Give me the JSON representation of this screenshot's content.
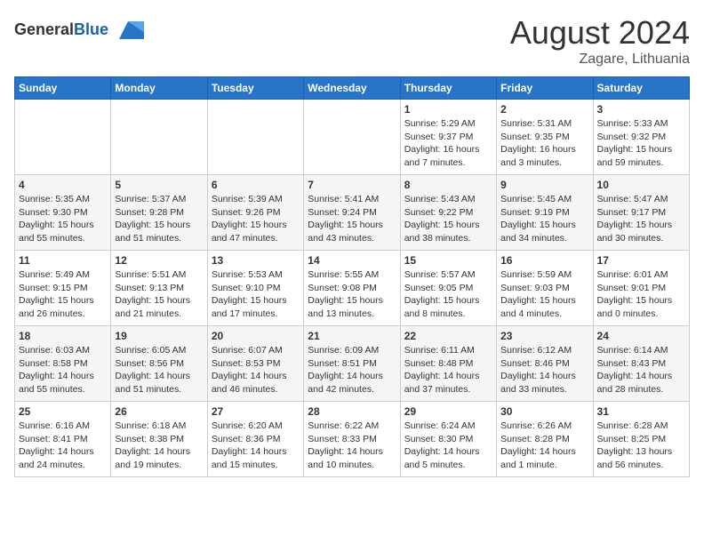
{
  "header": {
    "logo_general": "General",
    "logo_blue": "Blue",
    "month_title": "August 2024",
    "location": "Zagare, Lithuania"
  },
  "days_of_week": [
    "Sunday",
    "Monday",
    "Tuesday",
    "Wednesday",
    "Thursday",
    "Friday",
    "Saturday"
  ],
  "weeks": [
    [
      {
        "day": "",
        "info": ""
      },
      {
        "day": "",
        "info": ""
      },
      {
        "day": "",
        "info": ""
      },
      {
        "day": "",
        "info": ""
      },
      {
        "day": "1",
        "info": "Sunrise: 5:29 AM\nSunset: 9:37 PM\nDaylight: 16 hours\nand 7 minutes."
      },
      {
        "day": "2",
        "info": "Sunrise: 5:31 AM\nSunset: 9:35 PM\nDaylight: 16 hours\nand 3 minutes."
      },
      {
        "day": "3",
        "info": "Sunrise: 5:33 AM\nSunset: 9:32 PM\nDaylight: 15 hours\nand 59 minutes."
      }
    ],
    [
      {
        "day": "4",
        "info": "Sunrise: 5:35 AM\nSunset: 9:30 PM\nDaylight: 15 hours\nand 55 minutes."
      },
      {
        "day": "5",
        "info": "Sunrise: 5:37 AM\nSunset: 9:28 PM\nDaylight: 15 hours\nand 51 minutes."
      },
      {
        "day": "6",
        "info": "Sunrise: 5:39 AM\nSunset: 9:26 PM\nDaylight: 15 hours\nand 47 minutes."
      },
      {
        "day": "7",
        "info": "Sunrise: 5:41 AM\nSunset: 9:24 PM\nDaylight: 15 hours\nand 43 minutes."
      },
      {
        "day": "8",
        "info": "Sunrise: 5:43 AM\nSunset: 9:22 PM\nDaylight: 15 hours\nand 38 minutes."
      },
      {
        "day": "9",
        "info": "Sunrise: 5:45 AM\nSunset: 9:19 PM\nDaylight: 15 hours\nand 34 minutes."
      },
      {
        "day": "10",
        "info": "Sunrise: 5:47 AM\nSunset: 9:17 PM\nDaylight: 15 hours\nand 30 minutes."
      }
    ],
    [
      {
        "day": "11",
        "info": "Sunrise: 5:49 AM\nSunset: 9:15 PM\nDaylight: 15 hours\nand 26 minutes."
      },
      {
        "day": "12",
        "info": "Sunrise: 5:51 AM\nSunset: 9:13 PM\nDaylight: 15 hours\nand 21 minutes."
      },
      {
        "day": "13",
        "info": "Sunrise: 5:53 AM\nSunset: 9:10 PM\nDaylight: 15 hours\nand 17 minutes."
      },
      {
        "day": "14",
        "info": "Sunrise: 5:55 AM\nSunset: 9:08 PM\nDaylight: 15 hours\nand 13 minutes."
      },
      {
        "day": "15",
        "info": "Sunrise: 5:57 AM\nSunset: 9:05 PM\nDaylight: 15 hours\nand 8 minutes."
      },
      {
        "day": "16",
        "info": "Sunrise: 5:59 AM\nSunset: 9:03 PM\nDaylight: 15 hours\nand 4 minutes."
      },
      {
        "day": "17",
        "info": "Sunrise: 6:01 AM\nSunset: 9:01 PM\nDaylight: 15 hours\nand 0 minutes."
      }
    ],
    [
      {
        "day": "18",
        "info": "Sunrise: 6:03 AM\nSunset: 8:58 PM\nDaylight: 14 hours\nand 55 minutes."
      },
      {
        "day": "19",
        "info": "Sunrise: 6:05 AM\nSunset: 8:56 PM\nDaylight: 14 hours\nand 51 minutes."
      },
      {
        "day": "20",
        "info": "Sunrise: 6:07 AM\nSunset: 8:53 PM\nDaylight: 14 hours\nand 46 minutes."
      },
      {
        "day": "21",
        "info": "Sunrise: 6:09 AM\nSunset: 8:51 PM\nDaylight: 14 hours\nand 42 minutes."
      },
      {
        "day": "22",
        "info": "Sunrise: 6:11 AM\nSunset: 8:48 PM\nDaylight: 14 hours\nand 37 minutes."
      },
      {
        "day": "23",
        "info": "Sunrise: 6:12 AM\nSunset: 8:46 PM\nDaylight: 14 hours\nand 33 minutes."
      },
      {
        "day": "24",
        "info": "Sunrise: 6:14 AM\nSunset: 8:43 PM\nDaylight: 14 hours\nand 28 minutes."
      }
    ],
    [
      {
        "day": "25",
        "info": "Sunrise: 6:16 AM\nSunset: 8:41 PM\nDaylight: 14 hours\nand 24 minutes."
      },
      {
        "day": "26",
        "info": "Sunrise: 6:18 AM\nSunset: 8:38 PM\nDaylight: 14 hours\nand 19 minutes."
      },
      {
        "day": "27",
        "info": "Sunrise: 6:20 AM\nSunset: 8:36 PM\nDaylight: 14 hours\nand 15 minutes."
      },
      {
        "day": "28",
        "info": "Sunrise: 6:22 AM\nSunset: 8:33 PM\nDaylight: 14 hours\nand 10 minutes."
      },
      {
        "day": "29",
        "info": "Sunrise: 6:24 AM\nSunset: 8:30 PM\nDaylight: 14 hours\nand 5 minutes."
      },
      {
        "day": "30",
        "info": "Sunrise: 6:26 AM\nSunset: 8:28 PM\nDaylight: 14 hours\nand 1 minute."
      },
      {
        "day": "31",
        "info": "Sunrise: 6:28 AM\nSunset: 8:25 PM\nDaylight: 13 hours\nand 56 minutes."
      }
    ]
  ]
}
